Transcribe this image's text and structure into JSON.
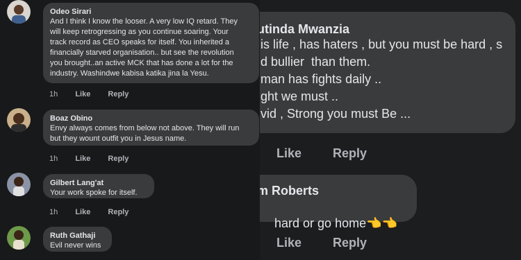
{
  "left_comments": [
    {
      "name": "Odeo Sirari",
      "text": "And I think I know the looser. A very low IQ retard. They\nwill keep retrogressing as you continue soaring. Your\ntrack record as CEO speaks for itself. You inherited a\nfinancially starved organisation.. but see the revolution\nyou brought..an active MCK that has done a lot for the\nindustry. Washindwe kabisa katika jina la Yesu.",
      "time": "1h",
      "like": "Like",
      "reply": "Reply"
    },
    {
      "name": "Boaz Obino",
      "text": "Envy always comes from below not above. They will run\nbut they wount outfit you in Jesus name.",
      "time": "1h",
      "like": "Like",
      "reply": "Reply"
    },
    {
      "name": "Gilbert Lang'at",
      "text": "Your work spoke for itself.",
      "time": "1h",
      "like": "Like",
      "reply": "Reply"
    },
    {
      "name": "Ruth Gathaji",
      "text": "Evil never wins"
    }
  ],
  "right_comments": [
    {
      "name": "utinda Mwanzia",
      "text": "is life , has haters , but you must be hard , s\nd bullier  than them.\nman has fights daily ..\nght we must ..\nvid , Strong you must Be ...",
      "like": "Like",
      "reply": "Reply"
    },
    {
      "name": "m Roberts",
      "text": "hard or go home",
      "emoji": "👈👈",
      "like": "Like",
      "reply": "Reply"
    }
  ],
  "colors": {
    "page_bg": "#18191a",
    "bubble": "#3a3b3c",
    "text": "#e4e6eb",
    "muted": "#b0b3b8"
  },
  "icons": {
    "emoji_hand": "backhand-index-pointing-left"
  }
}
